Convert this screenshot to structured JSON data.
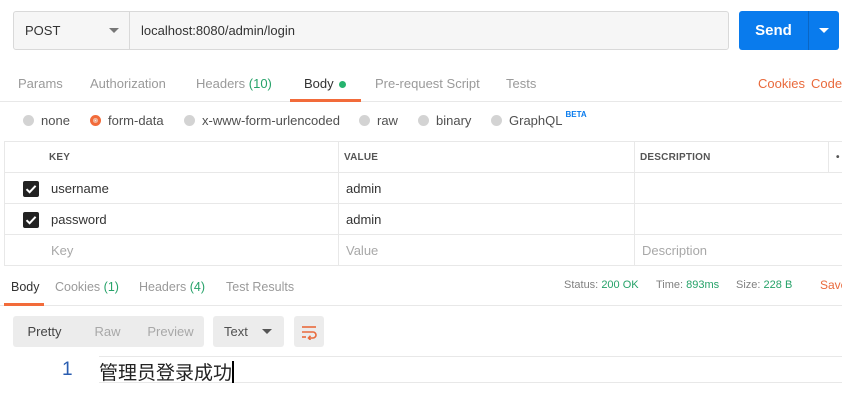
{
  "request": {
    "method": "POST",
    "url": "localhost:8080/admin/login",
    "send_label": "Send"
  },
  "request_tabs": {
    "params": "Params",
    "authorization": "Authorization",
    "headers": "Headers",
    "headers_count": "(10)",
    "body": "Body",
    "prerequest": "Pre-request Script",
    "tests": "Tests",
    "cookies": "Cookies",
    "code": "Code"
  },
  "body_types": {
    "none": "none",
    "form_data": "form-data",
    "urlencoded": "x-www-form-urlencoded",
    "raw": "raw",
    "binary": "binary",
    "graphql": "GraphQL",
    "beta": "BETA",
    "selected": "form-data"
  },
  "params_table": {
    "headers": {
      "key": "KEY",
      "value": "VALUE",
      "description": "DESCRIPTION",
      "more": "•"
    },
    "rows": [
      {
        "checked": true,
        "key": "username",
        "value": "admin",
        "description": ""
      },
      {
        "checked": true,
        "key": "password",
        "value": "admin",
        "description": ""
      }
    ],
    "placeholders": {
      "key": "Key",
      "value": "Value",
      "description": "Description"
    }
  },
  "response_tabs": {
    "body": "Body",
    "cookies": "Cookies",
    "cookies_count": "(1)",
    "headers": "Headers",
    "headers_count": "(4)",
    "test_results": "Test Results"
  },
  "response_status": {
    "status_label": "Status:",
    "status_value": "200 OK",
    "time_label": "Time:",
    "time_value": "893ms",
    "size_label": "Size:",
    "size_value": "228 B",
    "save": "Save"
  },
  "view_modes": {
    "pretty": "Pretty",
    "raw": "Raw",
    "preview": "Preview",
    "format": "Text"
  },
  "response_body": {
    "line_number": "1",
    "content": "管理员登录成功"
  },
  "colors": {
    "accent": "#f26b3a",
    "primary": "#097bed",
    "success": "#26a269"
  }
}
